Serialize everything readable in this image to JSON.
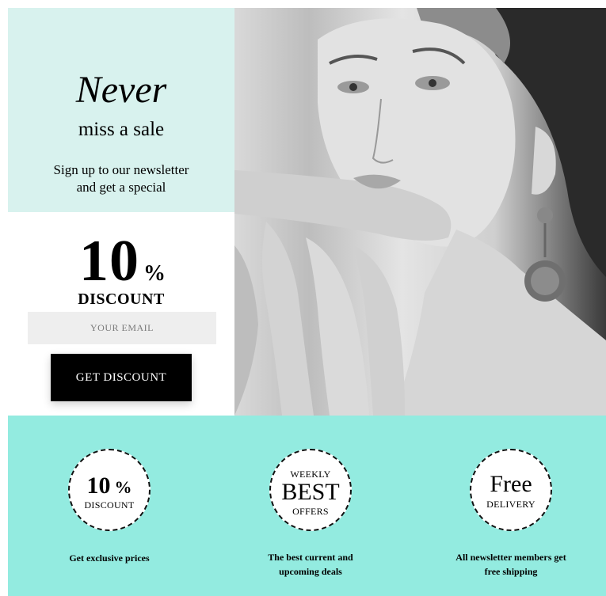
{
  "hero": {
    "headline_script": "Never",
    "headline_sub": "miss a sale",
    "signup_line1": "Sign up to our newsletter",
    "signup_line2": "and get a special",
    "offer_number": "10",
    "offer_percent": "%",
    "offer_word": "DISCOUNT",
    "email_placeholder": "YOUR EMAIL",
    "button_label": "GET DISCOUNT"
  },
  "features": [
    {
      "badge_big": "10",
      "badge_pct": "%",
      "badge_small": "DISCOUNT",
      "caption_line1": "Get exclusive prices",
      "caption_line2": ""
    },
    {
      "badge_top": "WEEKLY",
      "badge_big": "BEST",
      "badge_small": "OFFERS",
      "caption_line1": "The best current and",
      "caption_line2": "upcoming deals"
    },
    {
      "badge_big": "Free",
      "badge_small": "DELIVERY",
      "caption_line1": "All newsletter members get",
      "caption_line2": "free shipping"
    }
  ],
  "colors": {
    "mint_light": "#d8f2ee",
    "mint_strip": "#93ebe0",
    "button_bg": "#000000",
    "input_bg": "#eeeeee"
  }
}
